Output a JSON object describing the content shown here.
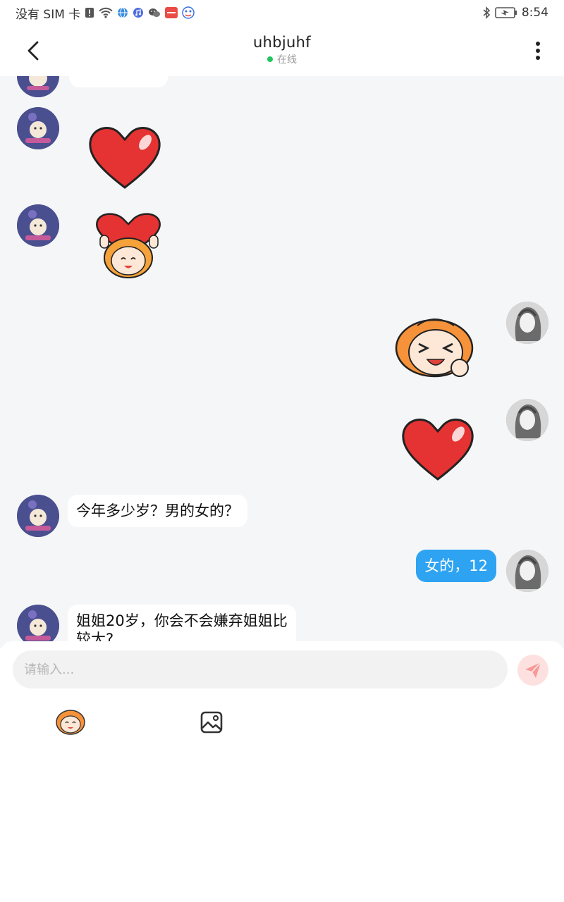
{
  "statusbar": {
    "carrier": "没有 SIM 卡",
    "time": "8:54",
    "icons": [
      "sim-alert-icon",
      "wifi-icon",
      "browser-icon",
      "music-icon",
      "wechat-icon",
      "app-icon",
      "baidu-icon",
      "bluetooth-icon",
      "battery-charging-icon"
    ]
  },
  "header": {
    "title": "uhbjuhf",
    "status": "在线",
    "status_color": "#22c55e",
    "icons": [
      "back-arrow-icon",
      "more-vertical-icon"
    ]
  },
  "chat": {
    "messages": [
      {
        "from": "other",
        "type": "text",
        "text": ""
      },
      {
        "from": "other",
        "type": "sticker",
        "sticker": "heart-sticker"
      },
      {
        "from": "other",
        "type": "sticker",
        "sticker": "girl-holding-heart-sticker"
      },
      {
        "from": "me",
        "type": "sticker",
        "sticker": "laughing-girl-sticker"
      },
      {
        "from": "me",
        "type": "sticker",
        "sticker": "heart-sticker"
      },
      {
        "from": "other",
        "type": "text",
        "text": "今年多少岁？男的女的？"
      },
      {
        "from": "me",
        "type": "text",
        "text": "女的，12"
      },
      {
        "from": "other",
        "type": "text",
        "text_line1": "姐姐20岁，你会不会嫌弃姐姐比",
        "text_line2": "较大?"
      }
    ]
  },
  "composer": {
    "placeholder": "请输入...",
    "value": "",
    "send_icon": "send-plane-icon",
    "tools": [
      "sticker-face-icon",
      "image-icon"
    ]
  },
  "colors": {
    "my_bubble": "#2ea3f2",
    "chat_bg": "#f5f6f8",
    "send_button_bg": "#fde1e0",
    "send_icon": "#f59a96"
  }
}
